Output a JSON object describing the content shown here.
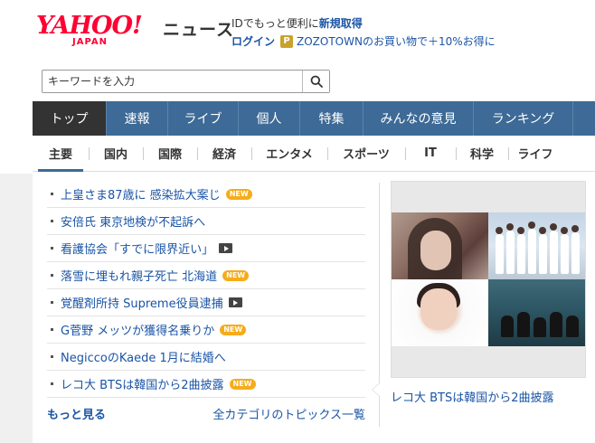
{
  "header": {
    "logo_main": "YAHOO!",
    "logo_sub": "JAPAN",
    "section": "ニュース",
    "promo_line1_prefix": "IDでもっと便利に",
    "promo_line1_link": "新規取得",
    "login": "ログイン",
    "zozo_icon": "P",
    "zozo_text": "ZOZOTOWNのお買い物で＋10%お得に"
  },
  "search": {
    "placeholder": "キーワードを入力",
    "icon": "search-icon"
  },
  "main_nav": [
    {
      "label": "トップ",
      "active": true
    },
    {
      "label": "速報"
    },
    {
      "label": "ライブ"
    },
    {
      "label": "個人"
    },
    {
      "label": "特集"
    },
    {
      "label": "みんなの意見"
    },
    {
      "label": "ランキング"
    }
  ],
  "sub_nav": [
    {
      "label": "主要",
      "active": true
    },
    {
      "label": "国内"
    },
    {
      "label": "国際"
    },
    {
      "label": "経済"
    },
    {
      "label": "エンタメ"
    },
    {
      "label": "スポーツ"
    },
    {
      "label": "IT"
    },
    {
      "label": "科学"
    },
    {
      "label": "ライフ"
    }
  ],
  "topics": [
    {
      "title": "上皇さま87歳に 感染拡大案じ",
      "badge": "NEW"
    },
    {
      "title": "安倍氏 東京地検が不起訴へ"
    },
    {
      "title": "看護協会「すでに限界近い」",
      "video": true
    },
    {
      "title": "落雪に埋もれ親子死亡 北海道",
      "badge": "NEW"
    },
    {
      "title": "覚醒剤所持 Supreme役員逮捕",
      "video": true
    },
    {
      "title": "G菅野 メッツが獲得名乗りか",
      "badge": "NEW"
    },
    {
      "title": "NegiccoのKaede 1月に結婚へ"
    },
    {
      "title": "レコ大 BTSは韓国から2曲披露",
      "badge": "NEW"
    }
  ],
  "more_link": "もっと見る",
  "all_topics_link": "全カテゴリのトピックス一覧",
  "photo": {
    "caption": "レコ大 BTSは韓国から2曲披露"
  },
  "colors": {
    "brand_red": "#ff0033",
    "nav_blue": "#3d6a96",
    "nav_active": "#333333",
    "link_blue": "#1a54a6",
    "new_badge": "#f5ac1b"
  }
}
